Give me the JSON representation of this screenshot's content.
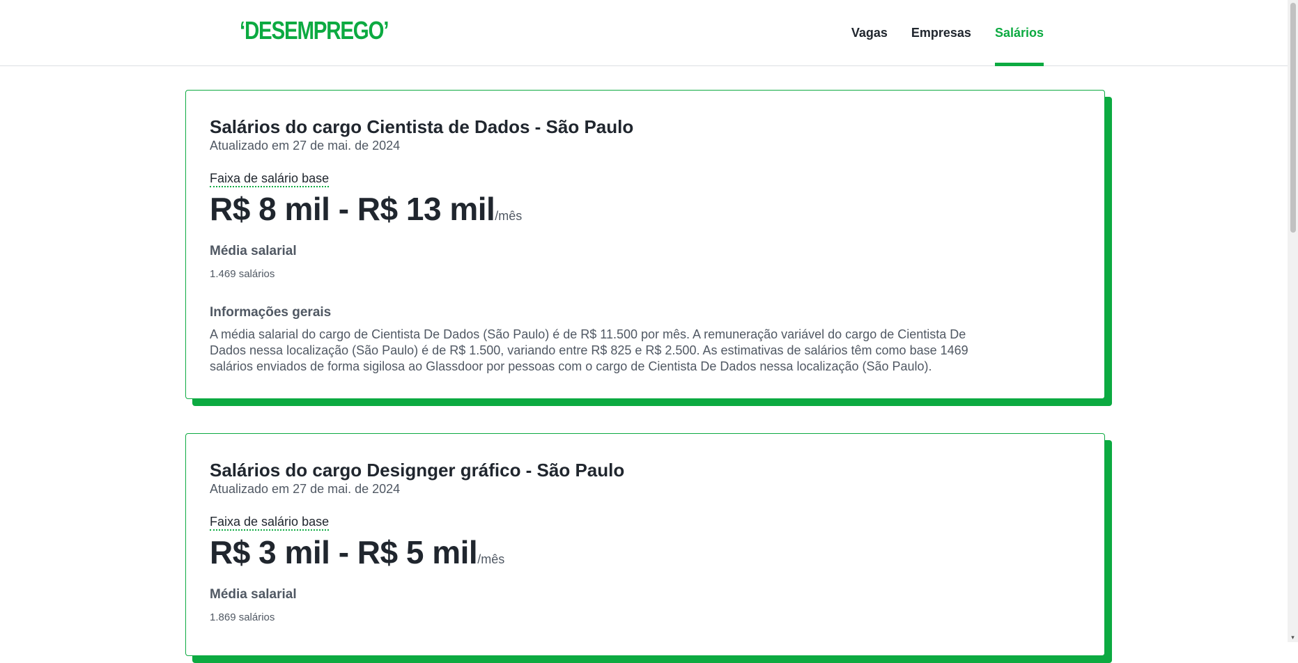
{
  "brand": {
    "logo": "‘DESEMPREGO’",
    "accent_color": "#0caa41"
  },
  "nav": {
    "items": [
      {
        "label": "Vagas",
        "active": false
      },
      {
        "label": "Empresas",
        "active": false
      },
      {
        "label": "Salários",
        "active": true
      }
    ]
  },
  "cards": [
    {
      "title": "Salários do cargo Cientista de Dados - São Paulo",
      "updated": "Atualizado em 27 de mai. de 2024",
      "range_label": "Faixa de salário base",
      "range": "R$ 8 mil - R$ 13 mil",
      "range_unit": "/mês",
      "avg_label": "Média salarial",
      "count": "1.469 salários",
      "info_title": "Informações gerais",
      "info_text": "A média salarial do cargo de Cientista De Dados (São Paulo) é de R$ 11.500 por mês. A remuneração variável do cargo de Cientista De Dados nessa localização (São Paulo) é de R$ 1.500, variando entre R$ 825 e R$ 2.500. As estimativas de salários têm como base 1469 salários enviados de forma sigilosa ao Glassdoor por pessoas com o cargo de Cientista De Dados nessa localização (São Paulo)."
    },
    {
      "title": "Salários do cargo Designger gráfico - São Paulo",
      "updated": "Atualizado em 27 de mai. de 2024",
      "range_label": "Faixa de salário base",
      "range": "R$ 3 mil - R$ 5 mil",
      "range_unit": "/mês",
      "avg_label": "Média salarial",
      "count": "1.869 salários"
    }
  ]
}
